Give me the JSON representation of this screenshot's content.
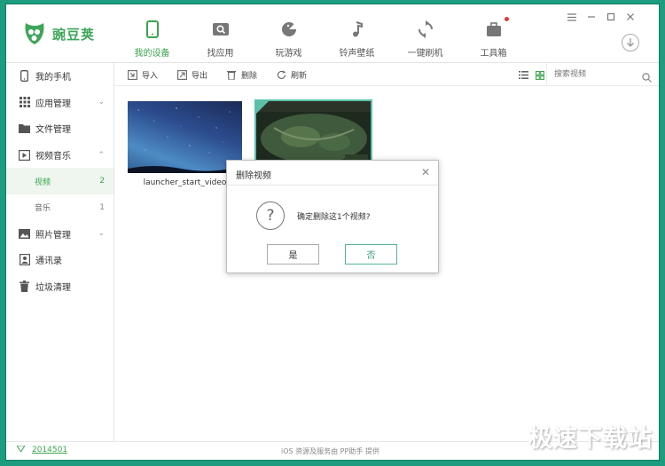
{
  "app": {
    "logo_text": "豌豆荚",
    "nav": [
      {
        "label": "我的设备",
        "icon": "phone-icon",
        "active": true
      },
      {
        "label": "找应用",
        "icon": "app-search-icon",
        "active": false
      },
      {
        "label": "玩游戏",
        "icon": "game-icon",
        "active": false
      },
      {
        "label": "铃声壁纸",
        "icon": "music-note-icon",
        "active": false
      },
      {
        "label": "一键刷机",
        "icon": "refresh-icon",
        "active": false
      },
      {
        "label": "工具箱",
        "icon": "toolbox-icon",
        "active": false,
        "badge": true
      }
    ],
    "window_controls": [
      "menu-icon",
      "minimize-icon",
      "maximize-icon",
      "close-icon"
    ]
  },
  "sidebar": {
    "items": [
      {
        "label": "我的手机",
        "icon": "phone-icon"
      },
      {
        "label": "应用管理",
        "icon": "grid-icon",
        "chevron": "down"
      },
      {
        "label": "文件管理",
        "icon": "folder-icon"
      },
      {
        "label": "视频音乐",
        "icon": "video-icon",
        "chevron": "up"
      },
      {
        "label": "视频",
        "count": "2",
        "sub": true,
        "active": true
      },
      {
        "label": "音乐",
        "count": "1",
        "sub": true
      },
      {
        "label": "照片管理",
        "icon": "image-icon",
        "chevron": "down"
      },
      {
        "label": "通讯录",
        "icon": "contacts-icon"
      },
      {
        "label": "垃圾清理",
        "icon": "trash-icon"
      }
    ]
  },
  "toolbar": {
    "import_label": "导入",
    "export_label": "导出",
    "delete_label": "删除",
    "refresh_label": "刷新",
    "search_placeholder": "搜索视频"
  },
  "videos": [
    {
      "title": "launcher_start_video",
      "selected": false
    },
    {
      "title": "",
      "selected": true
    }
  ],
  "dialog": {
    "title": "删除视频",
    "message": "确定删除这1个视频?",
    "yes_label": "是",
    "no_label": "否"
  },
  "status": {
    "version": "2014501",
    "service_text": "iOS 资源及服务由 PP助手 提供"
  },
  "watermark": "极速下载站",
  "colors": {
    "accent": "#3aa54d",
    "frame": "#1d9c7f",
    "selection": "#5cc0a9"
  }
}
